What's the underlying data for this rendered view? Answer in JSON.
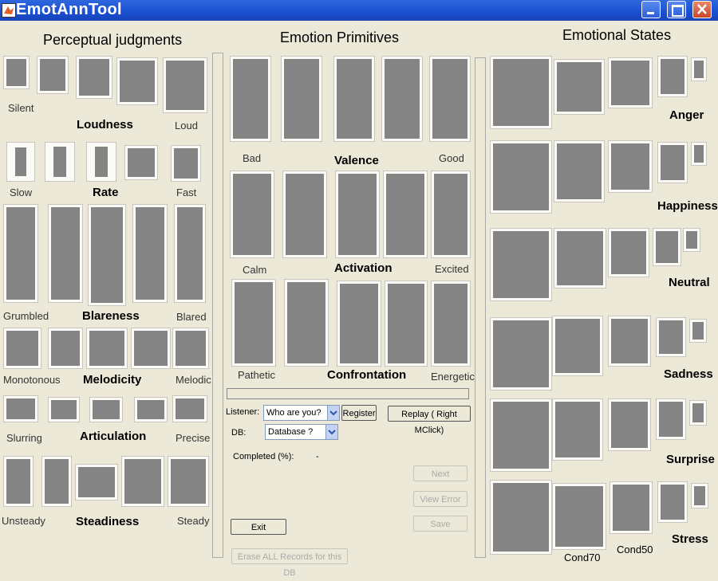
{
  "window": {
    "title": "EmotAnnTool"
  },
  "left": {
    "heading": "Perceptual judgments",
    "groups": {
      "loudness": {
        "title": "Loudness",
        "low": "Silent",
        "high": "Loud"
      },
      "rate": {
        "title": "Rate",
        "low": "Slow",
        "high": "Fast"
      },
      "blareness": {
        "title": "Blareness",
        "low": "Grumbled",
        "high": "Blared"
      },
      "melodicity": {
        "title": "Melodicity",
        "low": "Monotonous",
        "high": "Melodic"
      },
      "articulation": {
        "title": "Articulation",
        "low": "Slurring",
        "high": "Precise"
      },
      "steadiness": {
        "title": "Steadiness",
        "low": "Unsteady",
        "high": "Steady"
      }
    }
  },
  "middle": {
    "heading": "Emotion Primitives",
    "groups": {
      "valence": {
        "title": "Valence",
        "low": "Bad",
        "high": "Good"
      },
      "activation": {
        "title": "Activation",
        "low": "Calm",
        "high": "Excited"
      },
      "confrontation": {
        "title": "Confrontation",
        "low": "Pathetic",
        "high": "Energetic"
      }
    },
    "controls": {
      "listener_label": "Listener:",
      "listener_value": "Who are you?",
      "register": "Register",
      "replay": "Replay ( Right MClick)",
      "db_label": "DB:",
      "db_value": "Database ?",
      "completed_label": "Completed (%):",
      "completed_value": "-",
      "next": "Next",
      "view_error": "View Error",
      "save": "Save",
      "exit": "Exit",
      "erase": "Erase ALL Records for this DB"
    }
  },
  "right": {
    "heading": "Emotional States",
    "rows": {
      "anger": "Anger",
      "happiness": "Happiness",
      "neutral": "Neutral",
      "sadness": "Sadness",
      "surprise": "Surprise",
      "stress": "Stress"
    },
    "cond70": "Cond70",
    "cond50": "Cond50"
  },
  "colors": {
    "titlebar": "#1a4fd0",
    "background": "#ece9d8",
    "tile_fill": "#848484"
  }
}
